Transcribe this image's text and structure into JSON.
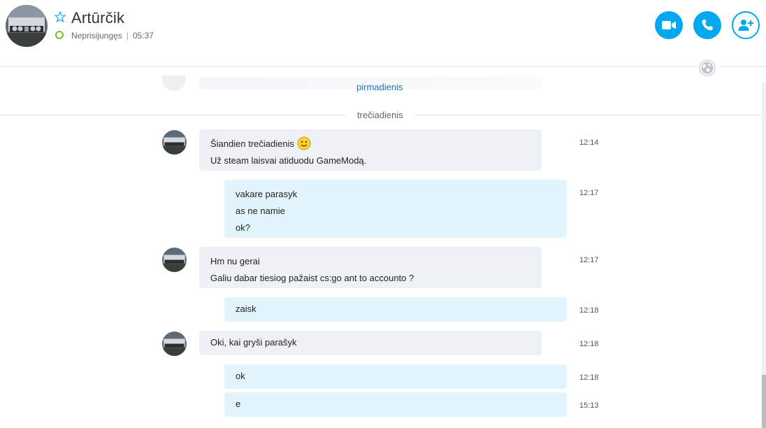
{
  "header": {
    "contact_name": "Artūrčik",
    "status": "Neprisijungęs",
    "local_time": "05:37",
    "status_color": "#7cbf1e",
    "accent_color": "#00a8f0",
    "icons": [
      "star-icon",
      "video-call-icon",
      "audio-call-icon",
      "add-contact-icon",
      "globe-icon"
    ]
  },
  "history": {
    "previous_day_link": "pirmadienis"
  },
  "day_separator": "trečiadienis",
  "messages": [
    {
      "direction": "in",
      "lines": [
        "Šiandien trečiadienis",
        "Už steam laisvai atiduodu GameModą."
      ],
      "emoji": "smiley-emoji",
      "time": "12:14"
    },
    {
      "direction": "out",
      "lines": [
        "vakare parasyk",
        "as ne namie",
        "ok?"
      ],
      "time": "12:17"
    },
    {
      "direction": "in",
      "lines": [
        "Hm nu gerai",
        "Galiu dabar tiesiog pažaist cs:go ant to accounto ?"
      ],
      "time": "12:17"
    },
    {
      "direction": "out",
      "lines": [
        "zaisk"
      ],
      "time": "12:18"
    },
    {
      "direction": "in",
      "lines": [
        "Oki, kai gryši parašyk"
      ],
      "time": "12:18"
    },
    {
      "direction": "out",
      "lines": [
        "ok"
      ],
      "time": "12:18"
    },
    {
      "direction": "out",
      "lines": [
        "e"
      ],
      "time": "15:13"
    }
  ]
}
